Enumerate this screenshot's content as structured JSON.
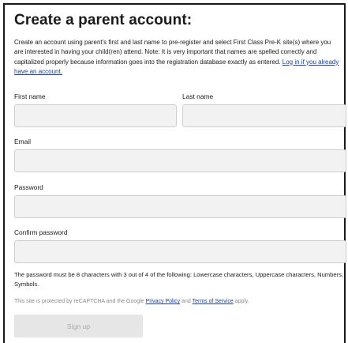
{
  "form": {
    "title": "Create a parent account:",
    "intro_text": "Create an account using parent's first and last name to pre-register and select First Class Pre-K site(s) where you are interested in having your child(ren) attend. Note: It is very important that names are spelled correctly and capitalized properly because information goes into the registration database exactly as entered.",
    "login_link": "Log in if you already have an account.",
    "first_name": {
      "label": "First name",
      "value": ""
    },
    "last_name": {
      "label": "Last name",
      "value": ""
    },
    "email": {
      "label": "Email",
      "value": ""
    },
    "password": {
      "label": "Password",
      "value": ""
    },
    "confirm_password": {
      "label": "Confirm password",
      "value": ""
    },
    "password_rules": "The password must be 8 characters with 3 out of 4 of the following: Lowercase characters, Uppercase characters, Numbers, Symbols.",
    "captcha": {
      "prefix": "This site is protected by reCAPTCHA and the Google",
      "privacy_link": "Privacy Policy",
      "and": "and",
      "terms_link": "Terms of Service",
      "suffix": "apply."
    },
    "signup_label": "Sign up"
  }
}
